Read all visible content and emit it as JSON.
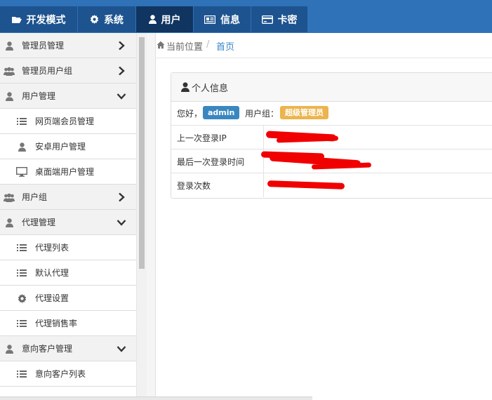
{
  "nav": {
    "tabs": [
      {
        "label": "开发模式",
        "icon": "folder-open-icon"
      },
      {
        "label": "系统",
        "icon": "gear-icon"
      },
      {
        "label": "用户",
        "icon": "user-icon"
      },
      {
        "label": "信息",
        "icon": "newspaper-icon"
      },
      {
        "label": "卡密",
        "icon": "card-icon"
      }
    ],
    "active_tab": "用户"
  },
  "sidebar": {
    "items": [
      {
        "label": "管理员管理",
        "icon": "user-icon",
        "type": "group",
        "arrow": "right"
      },
      {
        "label": "管理员用户组",
        "icon": "users-icon",
        "type": "group",
        "arrow": "right"
      },
      {
        "label": "用户管理",
        "icon": "user-icon",
        "type": "group",
        "arrow": "down"
      },
      {
        "label": "网页端会员管理",
        "icon": "list-icon",
        "type": "sub"
      },
      {
        "label": "安卓用户管理",
        "icon": "user-icon",
        "type": "sub"
      },
      {
        "label": "桌面端用户管理",
        "icon": "desktop-icon",
        "type": "sub"
      },
      {
        "label": "用户组",
        "icon": "users-icon",
        "type": "group",
        "arrow": "right"
      },
      {
        "label": "代理管理",
        "icon": "user-icon",
        "type": "group",
        "arrow": "down"
      },
      {
        "label": "代理列表",
        "icon": "list-icon",
        "type": "sub"
      },
      {
        "label": "默认代理",
        "icon": "list-icon",
        "type": "sub"
      },
      {
        "label": "代理设置",
        "icon": "gear-icon",
        "type": "sub"
      },
      {
        "label": "代理销售率",
        "icon": "list-icon",
        "type": "sub"
      },
      {
        "label": "意向客户管理",
        "icon": "user-icon",
        "type": "group",
        "arrow": "down"
      },
      {
        "label": "意向客户列表",
        "icon": "list-icon",
        "type": "sub"
      }
    ]
  },
  "breadcrumb": {
    "current_label": "当前位置",
    "separator": "/",
    "home_link": "首页"
  },
  "profile": {
    "title": "个人信息",
    "greeting": "您好，",
    "username": "admin",
    "group_label": "用户组：",
    "group_name": "超级管理员",
    "rows": [
      {
        "label": "上一次登录IP"
      },
      {
        "label": "最后一次登录时间"
      },
      {
        "label": "登录次数"
      }
    ]
  },
  "colors": {
    "nav_bg": "#2f72b8",
    "nav_tab": "#1d538f",
    "nav_active": "#0f3560",
    "badge_user": "#3a87c0",
    "badge_role": "#ecb44c",
    "link": "#3a86c8",
    "redaction": "#f00000"
  }
}
